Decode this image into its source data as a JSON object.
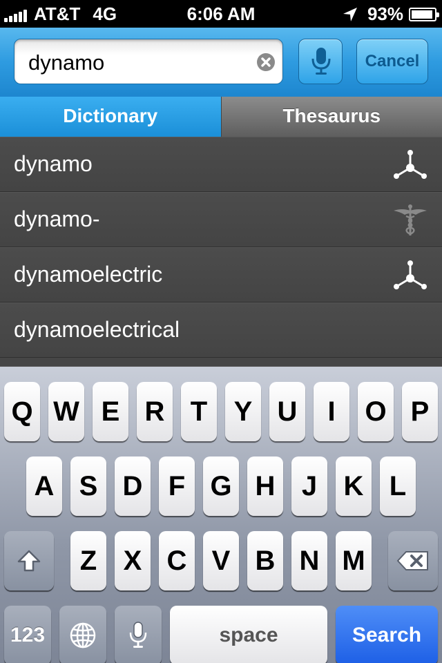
{
  "status_bar": {
    "carrier": "AT&T",
    "network": "4G",
    "time": "6:06 AM",
    "battery_percent": "93%",
    "battery_level": 0.93,
    "signal_bars": 5
  },
  "search": {
    "query": "dynamo",
    "cancel_label": "Cancel",
    "mic_icon": "microphone-icon",
    "clear_icon": "clear-circle-icon"
  },
  "tabs": [
    {
      "label": "Dictionary",
      "active": true
    },
    {
      "label": "Thesaurus",
      "active": false
    }
  ],
  "results": [
    {
      "word": "dynamo",
      "icon": "network-science-icon"
    },
    {
      "word": "dynamo-",
      "icon": "caduceus-medical-icon"
    },
    {
      "word": "dynamoelectric",
      "icon": "network-science-icon"
    },
    {
      "word": "dynamoelectrical",
      "icon": ""
    }
  ],
  "keyboard": {
    "row1": [
      "Q",
      "W",
      "E",
      "R",
      "T",
      "Y",
      "U",
      "I",
      "O",
      "P"
    ],
    "row2": [
      "A",
      "S",
      "D",
      "F",
      "G",
      "H",
      "J",
      "K",
      "L"
    ],
    "row3": [
      "Z",
      "X",
      "C",
      "V",
      "B",
      "N",
      "M"
    ],
    "numbers_label": "123",
    "space_label": "space",
    "search_label": "Search"
  },
  "colors": {
    "accent_blue": "#2e9be0",
    "search_key_blue": "#1d5fe6"
  }
}
